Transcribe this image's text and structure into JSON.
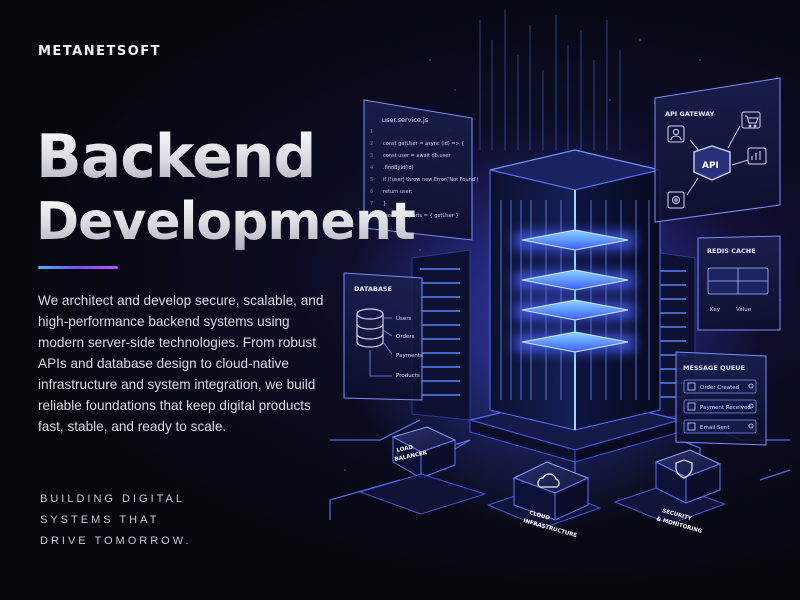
{
  "brand": "METANETSOFT",
  "hero": {
    "title_line1": "Backend",
    "title_line2": "Development",
    "description": "We architect and develop secure, scalable, and high-performance backend systems using modern server-side technologies. From robust APIs and database design to cloud-native infrastructure and system integration, we build reliable foundations that keep digital products fast, stable, and ready to scale.",
    "tagline": [
      "BUILDING DIGITAL",
      "SYSTEMS THAT",
      "DRIVE TOMORROW."
    ]
  },
  "code_panel": {
    "filename": "user.service.js",
    "lines": [
      "const getUser = async (id) => {",
      "  const user = await db.user",
      "    .findById(id)",
      "  if (!user) throw new Error('Not Found')",
      "  return user;",
      "}",
      "module.exports = { getUser }"
    ]
  },
  "database_panel": {
    "title": "DATABASE",
    "items": [
      "Users",
      "Orders",
      "Payments",
      "Products"
    ]
  },
  "api_panel": {
    "title": "API GATEWAY",
    "center": "API"
  },
  "cache_panel": {
    "title": "REDIS CACHE",
    "key_label": "Key",
    "value_label": "Value"
  },
  "queue_panel": {
    "title": "MESSAGE QUEUE",
    "items": [
      "Order Created",
      "Payment Received",
      "Email Sent"
    ]
  },
  "blocks": {
    "load_balancer": [
      "LOAD",
      "BALANCER"
    ],
    "cloud": [
      "CLOUD",
      "INFRASTRUCTURE"
    ],
    "security": [
      "SECURITY",
      "& MONITORING"
    ]
  },
  "colors": {
    "accent_blue": "#3f7dff",
    "accent_purple": "#8a4dff",
    "glow_cyan": "#6fd0ff"
  }
}
